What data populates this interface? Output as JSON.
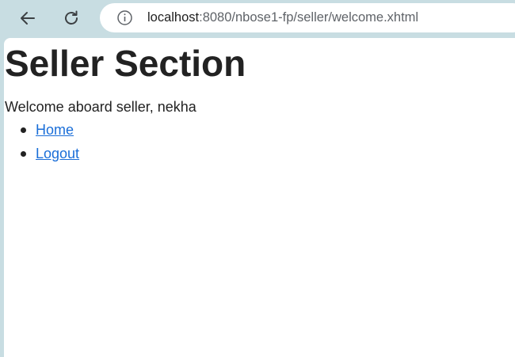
{
  "browser": {
    "back_icon": "back-arrow-icon",
    "reload_icon": "reload-icon",
    "site_info_icon": "info-icon",
    "url_host": "localhost",
    "url_path": ":8080/nbose1-fp/seller/welcome.xhtml"
  },
  "page": {
    "title": "Seller Section",
    "welcome_text": "Welcome aboard seller, nekha",
    "links": [
      {
        "label": "Home"
      },
      {
        "label": "Logout"
      }
    ]
  },
  "colors": {
    "toolbar_bg": "#c8dde2",
    "link": "#1a6ed8",
    "text": "#222222"
  }
}
